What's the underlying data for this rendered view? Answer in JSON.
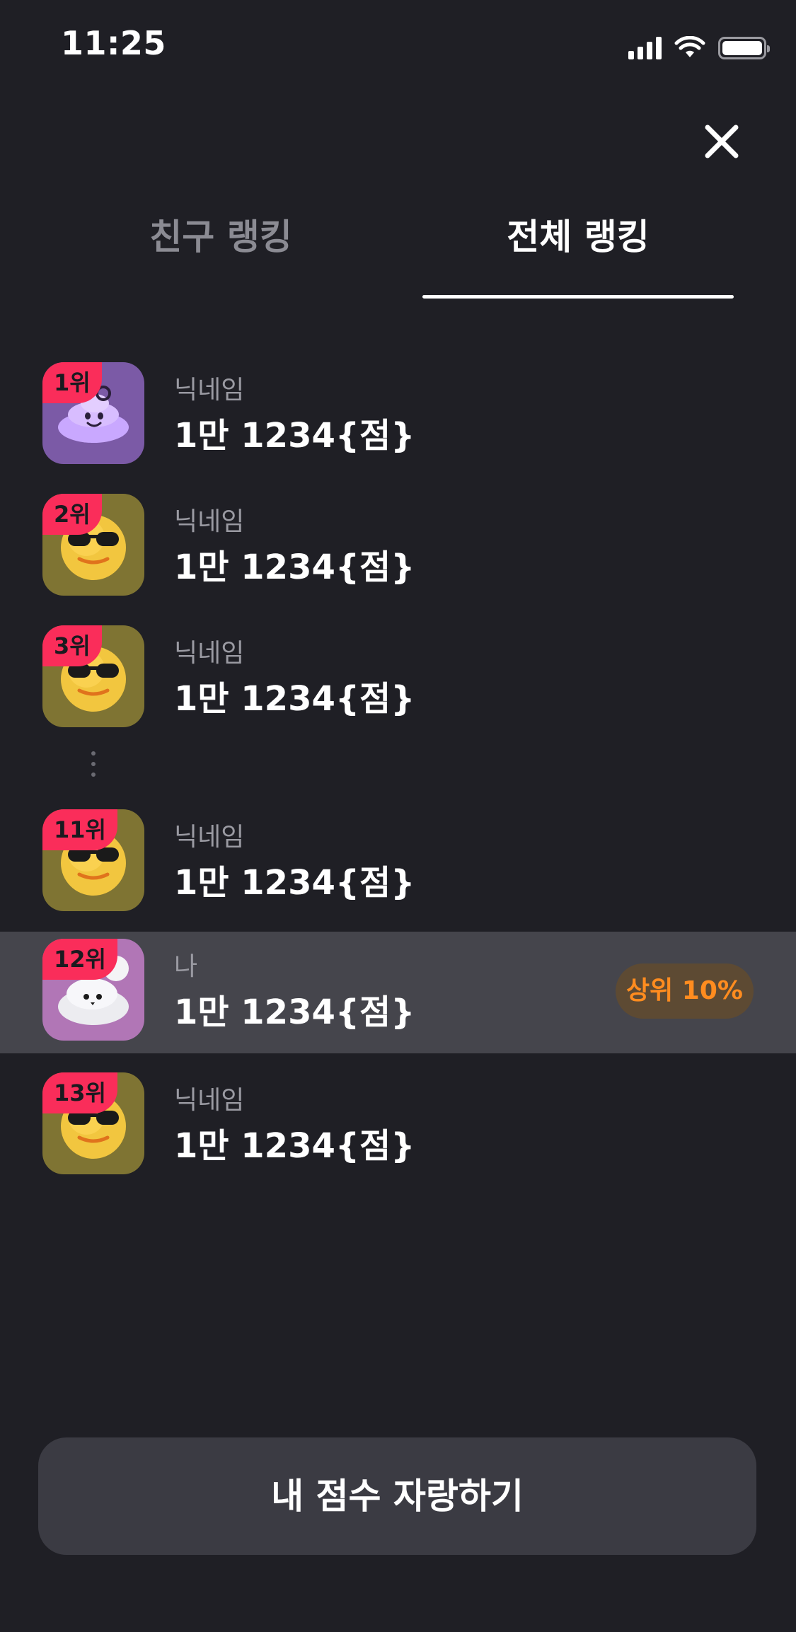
{
  "status_bar": {
    "time": "11:25",
    "signal_icon": "cellular-signal-icon",
    "wifi_icon": "wifi-icon",
    "battery_icon": "battery-icon"
  },
  "header": {
    "close_icon": "close-icon"
  },
  "tabs": [
    {
      "label": "친구 랭킹",
      "active": false
    },
    {
      "label": "전체 랭킹",
      "active": true
    }
  ],
  "ranking": {
    "rows": [
      {
        "rank": "1위",
        "name": "닉네임",
        "score": "1만 1234{점}",
        "avatar": "purple-blob-avatar"
      },
      {
        "rank": "2위",
        "name": "닉네임",
        "score": "1만 1234{점}",
        "avatar": "sunglasses-smiley-avatar"
      },
      {
        "rank": "3위",
        "name": "닉네임",
        "score": "1만 1234{점}",
        "avatar": "sunglasses-smiley-avatar"
      },
      {
        "rank": "11위",
        "name": "닉네임",
        "score": "1만 1234{점}",
        "avatar": "sunglasses-smiley-avatar"
      },
      {
        "rank": "12위",
        "name": "나",
        "score": "1만 1234{점}",
        "avatar": "white-blob-avatar",
        "is_me": true,
        "badge": "상위 10%"
      },
      {
        "rank": "13위",
        "name": "닉네임",
        "score": "1만 1234{점}",
        "avatar": "sunglasses-smiley-avatar"
      }
    ],
    "gap_icon": "vertical-ellipsis-icon"
  },
  "footer": {
    "share_label": "내 점수 자랑하기"
  },
  "colors": {
    "background": "#1f1f25",
    "highlight_row": "#45454c",
    "rank_badge": "#fa2d5a",
    "top_badge_bg": "#5d4a33",
    "top_badge_text": "#ff8c1f",
    "button_bg": "#3b3b43"
  }
}
